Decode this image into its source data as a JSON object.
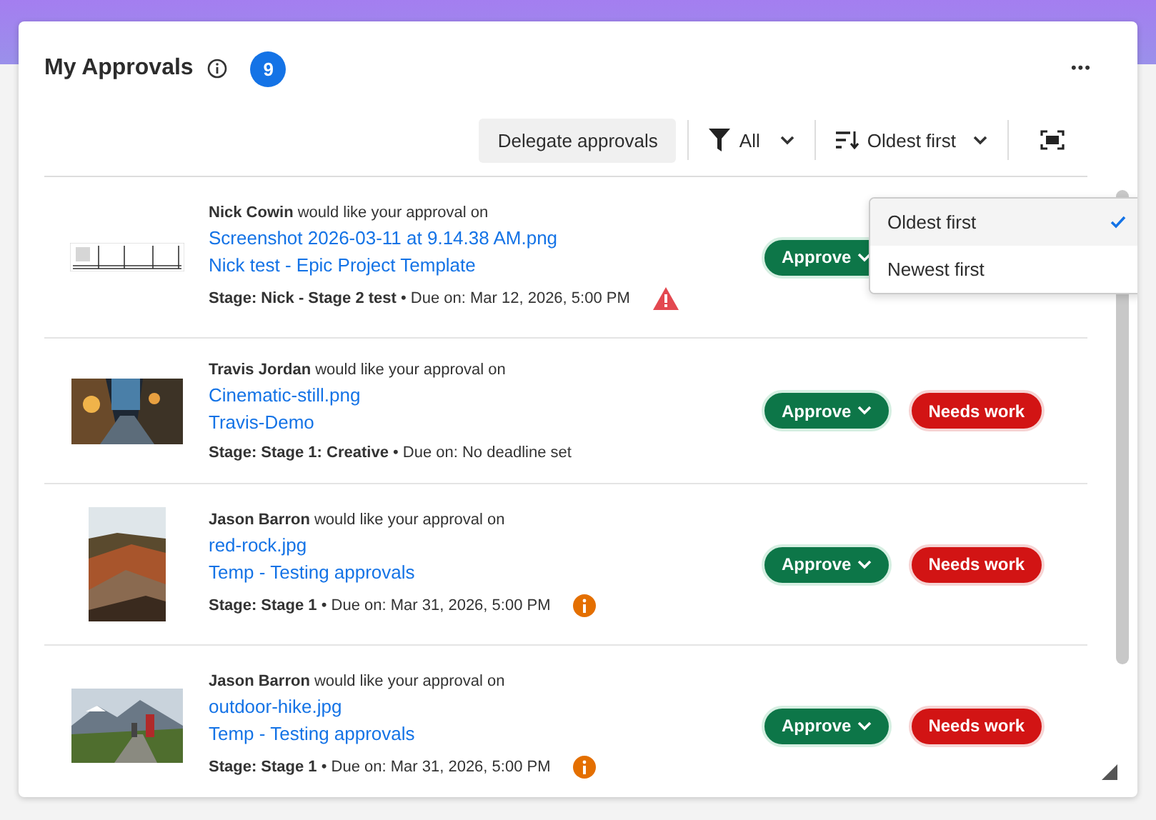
{
  "header": {
    "title": "My Approvals",
    "count": "9",
    "menu": "•••"
  },
  "toolbar": {
    "delegate": "Delegate approvals",
    "filter": "All",
    "sort": "Oldest first"
  },
  "sort_menu": {
    "options": [
      {
        "label": "Oldest first",
        "selected": true
      },
      {
        "label": "Newest first",
        "selected": false
      }
    ]
  },
  "approvals": [
    {
      "request": "**Nick Cowin** would like your approval on",
      "file": "Screenshot 2026-03-11 at 9.14.38 AM.png",
      "project": "Nick test - Epic Project Template",
      "stage": "**Stage: Nick - Stage 2 test** • Due on: Mar 12, 2026, 5:00 PM",
      "alert": {
        "kind": "warning"
      },
      "actions": [
        {
          "kind": "approve",
          "label": "Approve"
        }
      ]
    },
    {
      "request": "**Travis Jordan** would like your approval on",
      "file": "Cinematic-still.png",
      "project": "Travis-Demo",
      "stage": "**Stage: Stage 1: Creative** • Due on: No deadline set",
      "actions": [
        {
          "kind": "approve",
          "label": "Approve"
        },
        {
          "kind": "reject",
          "label": "Needs work"
        }
      ]
    },
    {
      "request": "**Jason Barron** would like your approval on",
      "file": "red-rock.jpg",
      "project": "Temp - Testing approvals",
      "stage": "**Stage: Stage 1** • Due on: Mar 31, 2026, 5:00 PM",
      "alert": {
        "kind": "info"
      },
      "actions": [
        {
          "kind": "approve",
          "label": "Approve"
        },
        {
          "kind": "reject",
          "label": "Needs work"
        }
      ]
    },
    {
      "request": "**Jason Barron** would like your approval on",
      "file": "outdoor-hike.jpg",
      "project": "Temp - Testing approvals",
      "stage": "**Stage: Stage 1** • Due on: Mar 31, 2026, 5:00 PM",
      "alert": {
        "kind": "info"
      },
      "actions": [
        {
          "kind": "approve",
          "label": "Approve"
        },
        {
          "kind": "reject",
          "label": "Needs work"
        }
      ]
    }
  ]
}
